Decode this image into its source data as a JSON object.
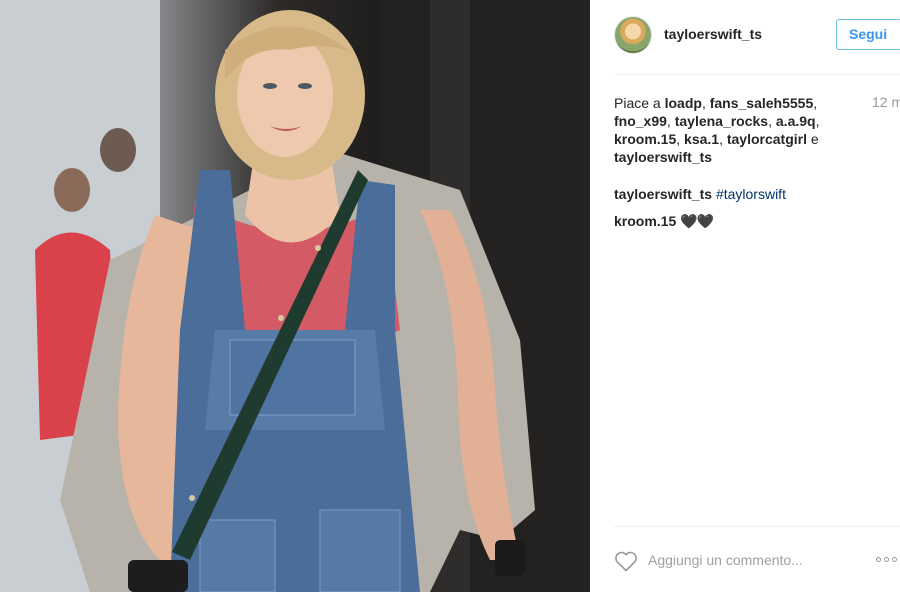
{
  "post": {
    "username": "tayloerswift_ts",
    "follow_label": "Segui",
    "likes_prefix": "Piace a ",
    "likers": [
      "loadp",
      "fans_saleh5555",
      "fno_x99",
      "taylena_rocks",
      "a.a.9q",
      "kroom.15",
      "ksa.1",
      "taylorcatgirl"
    ],
    "likes_joiner": " e ",
    "last_liker": "tayloerswift_ts",
    "time_label": "12 m",
    "caption": {
      "user": "tayloerswift_ts",
      "hashtag": "#taylorswift"
    },
    "comment": {
      "user": "kroom.15",
      "text": "🖤🖤"
    },
    "add_comment_placeholder": "Aggiungi un commento..."
  },
  "icons": {
    "like": "heart-outline-icon",
    "more": "more-options-icon"
  },
  "colors": {
    "follow_blue": "#3897f0",
    "hashtag": "#003569",
    "muted": "#999999"
  }
}
